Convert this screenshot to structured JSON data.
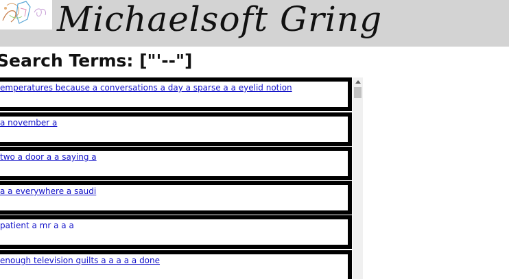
{
  "header": {
    "site_title": "Michaelsoft Gring"
  },
  "search": {
    "heading": "Search Terms: [\"'--\"]"
  },
  "results": [
    {
      "text": "emperatures because a conversations a day a sparse a a eyelid notion",
      "linked": true
    },
    {
      "text": "a november a",
      "linked": true
    },
    {
      "text": "two a door a a saying a",
      "linked": true
    },
    {
      "text": "a a everywhere a saudi",
      "linked": true
    },
    {
      "text": "patient a mr a a a",
      "linked": false
    },
    {
      "text": "enough television quilts a a a a a done",
      "linked": true
    }
  ],
  "colors": {
    "header_bg": "#d3d3d3",
    "link": "#1010c8",
    "border": "#000000"
  },
  "icons": {
    "logo": "logo-sketch-image",
    "scroll_up": "triangle-up"
  }
}
